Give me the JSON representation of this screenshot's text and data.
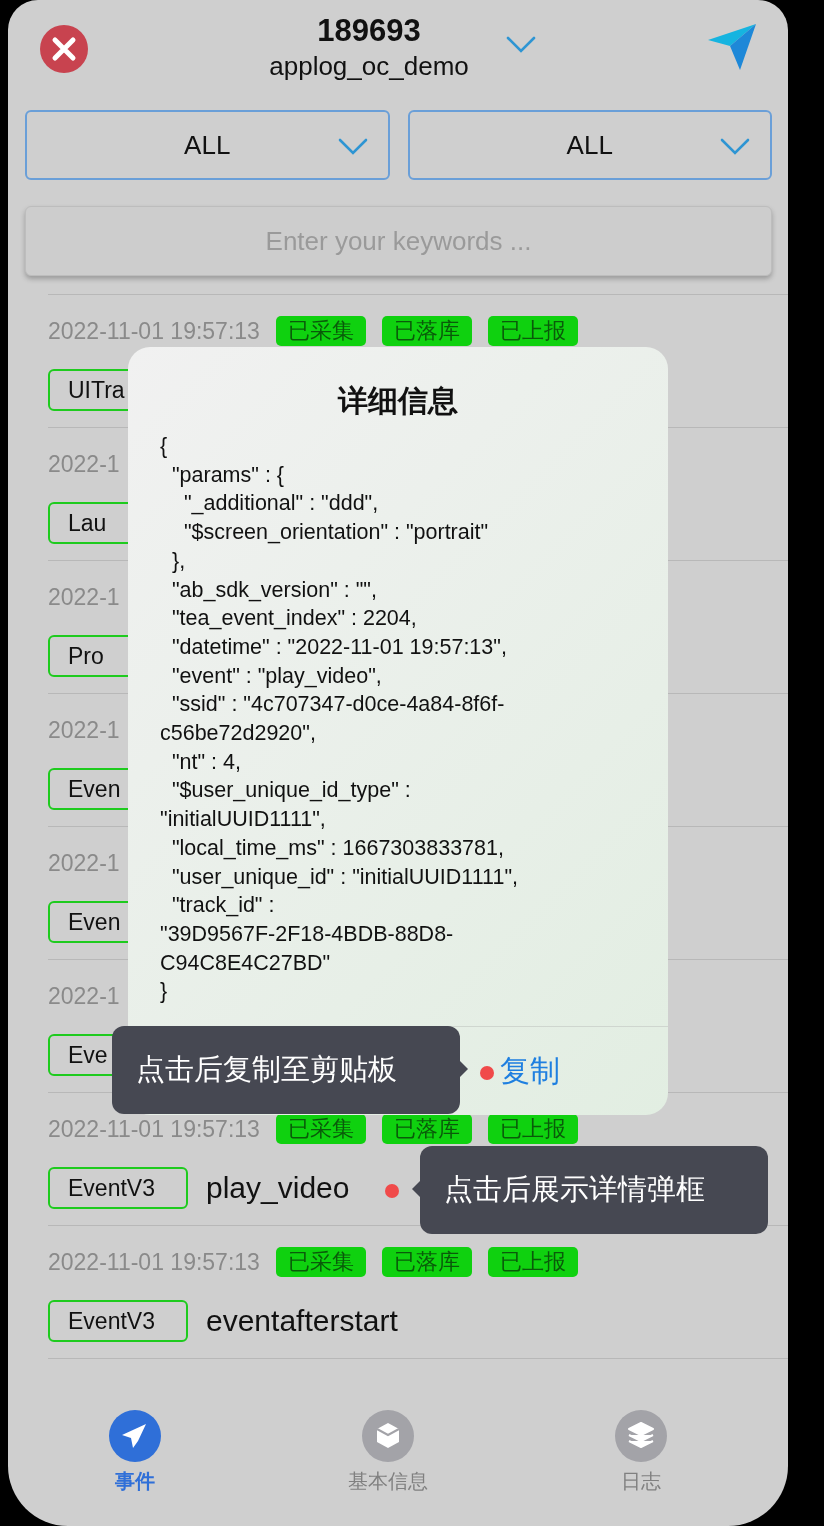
{
  "header": {
    "app_id": "189693",
    "app_name": "applog_oc_demo"
  },
  "filters": [
    {
      "value": "ALL"
    },
    {
      "value": "ALL"
    }
  ],
  "search": {
    "placeholder": "Enter your keywords ..."
  },
  "events": [
    {
      "time": "2022-11-01 19:57:13",
      "type": "UITra",
      "statuses": [
        "已采集",
        "已落库",
        "已上报"
      ]
    },
    {
      "time": "2022-1",
      "type": "Lau"
    },
    {
      "time": "2022-1",
      "type": "Pro"
    },
    {
      "time": "2022-1",
      "type": "Even"
    },
    {
      "time": "2022-1",
      "type": "Even"
    },
    {
      "time": "2022-1",
      "type": "Eve"
    },
    {
      "time": "2022-11-01 19:57:13",
      "type": "EventV3",
      "name": "play_video",
      "statuses": [
        "已采集",
        "已落库",
        "已上报"
      ]
    },
    {
      "time": "2022-11-01 19:57:13",
      "type": "EventV3",
      "name": "eventafterstart",
      "statuses": [
        "已采集",
        "已落库",
        "已上报"
      ]
    }
  ],
  "dialog": {
    "title": "详细信息",
    "lines": [
      "{",
      "  \"params\" : {",
      "    \"_additional\" : \"ddd\",",
      "    \"$screen_orientation\" : \"portrait\"",
      "  },",
      "  \"ab_sdk_version\" : \"\",",
      "  \"tea_event_index\" : 2204,",
      "  \"datetime\" : \"2022-11-01 19:57:13\",",
      "  \"event\" : \"play_video\",",
      "  \"ssid\" : \"4c707347-d0ce-4a84-8f6f-",
      "c56be72d2920\",",
      "  \"nt\" : 4,",
      "  \"$user_unique_id_type\" :",
      "\"initialUUID1111\",",
      "  \"local_time_ms\" : 1667303833781,",
      "  \"user_unique_id\" : \"initialUUID1111\",",
      "  \"track_id\" :",
      "\"39D9567F-2F18-4BDB-88D8-",
      "C94C8E4C27BD\"",
      "}"
    ],
    "action": "复制"
  },
  "hints": [
    {
      "kind": "copy",
      "text": "点击后复制至剪贴板"
    },
    {
      "kind": "row",
      "text": "点击后展示详情弹框"
    }
  ],
  "tabs": [
    {
      "label": "事件",
      "kind": "events",
      "selected": true
    },
    {
      "label": "基本信息",
      "kind": "info",
      "selected": false
    },
    {
      "label": "日志",
      "kind": "log",
      "selected": false
    }
  ]
}
